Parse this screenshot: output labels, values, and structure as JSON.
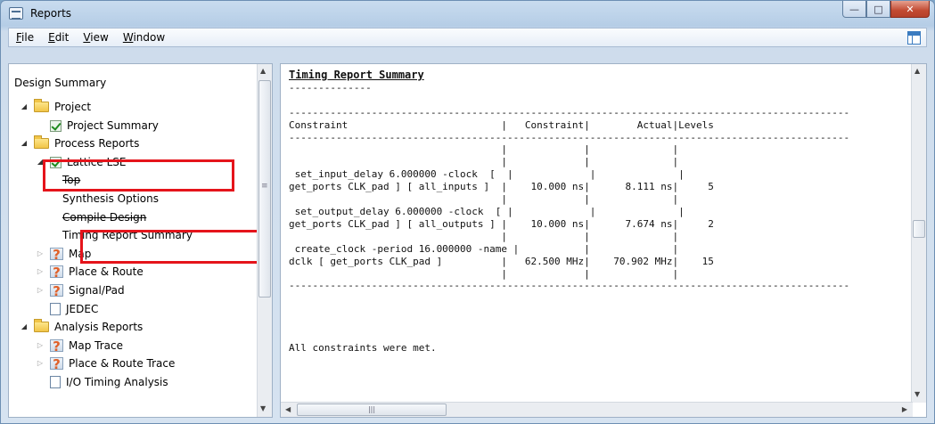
{
  "window": {
    "title": "Reports"
  },
  "menu": [
    {
      "label": "File",
      "u": "F",
      "rest": "ile"
    },
    {
      "label": "Edit",
      "u": "E",
      "rest": "dit"
    },
    {
      "label": "View",
      "u": "V",
      "rest": "iew"
    },
    {
      "label": "Window",
      "u": "W",
      "rest": "indow"
    }
  ],
  "tree": {
    "header": "Design Summary",
    "items": [
      {
        "label": "Project",
        "icon": "folder-icon",
        "indent": 0,
        "expander": "open"
      },
      {
        "label": "Project Summary",
        "icon": "check-icon",
        "indent": 1,
        "expander": "none"
      },
      {
        "label": "Process Reports",
        "icon": "folder-icon",
        "indent": 0,
        "expander": "open"
      },
      {
        "label": "Lattice LSE",
        "icon": "check-icon",
        "indent": 1,
        "expander": "open"
      },
      {
        "label": "Top",
        "icon": "none",
        "indent": 2,
        "expander": "none",
        "partial": true
      },
      {
        "label": "Synthesis Options",
        "icon": "none",
        "indent": 2,
        "expander": "none"
      },
      {
        "label": "Compile Design",
        "icon": "none",
        "indent": 2,
        "expander": "none",
        "partial": true
      },
      {
        "label": "Timing Report Summary",
        "icon": "none",
        "indent": 2,
        "expander": "none"
      },
      {
        "label": "Map",
        "icon": "warn-icon",
        "indent": 1,
        "expander": "closed"
      },
      {
        "label": "Place & Route",
        "icon": "warn-icon",
        "indent": 1,
        "expander": "closed"
      },
      {
        "label": "Signal/Pad",
        "icon": "warn-icon",
        "indent": 1,
        "expander": "closed"
      },
      {
        "label": "JEDEC",
        "icon": "doc-icon",
        "indent": 1,
        "expander": "none"
      },
      {
        "label": "Analysis Reports",
        "icon": "folder-icon",
        "indent": 0,
        "expander": "open"
      },
      {
        "label": "Map Trace",
        "icon": "warn-icon",
        "indent": 1,
        "expander": "closed"
      },
      {
        "label": "Place & Route Trace",
        "icon": "warn-icon",
        "indent": 1,
        "expander": "closed"
      },
      {
        "label": "I/O Timing Analysis",
        "icon": "doc-icon",
        "indent": 1,
        "expander": "none"
      }
    ]
  },
  "report": {
    "title": "Timing Report Summary",
    "title_rule": "--------------",
    "rule": "-----------------------------------------------------------------------------------------------",
    "header": "Constraint                          |   Constraint|        Actual|Levels",
    "body": [
      "                                    |             |              |",
      "                                    |             |              |",
      " set_input_delay 6.000000 -clock  [  |             |              |",
      "get_ports CLK_pad ] [ all_inputs ]  |    10.000 ns|      8.111 ns|     5",
      "                                    |             |              |",
      " set_output_delay 6.000000 -clock  [ |             |              |",
      "get_ports CLK_pad ] [ all_outputs ] |    10.000 ns|      7.674 ns|     2",
      "                                    |             |              |",
      " create_clock -period 16.000000 -name |           |              |",
      "dclk [ get_ports CLK_pad ]          |   62.500 MHz|    70.902 MHz|    15",
      "                                    |             |              |"
    ],
    "footer": "All constraints were met."
  }
}
